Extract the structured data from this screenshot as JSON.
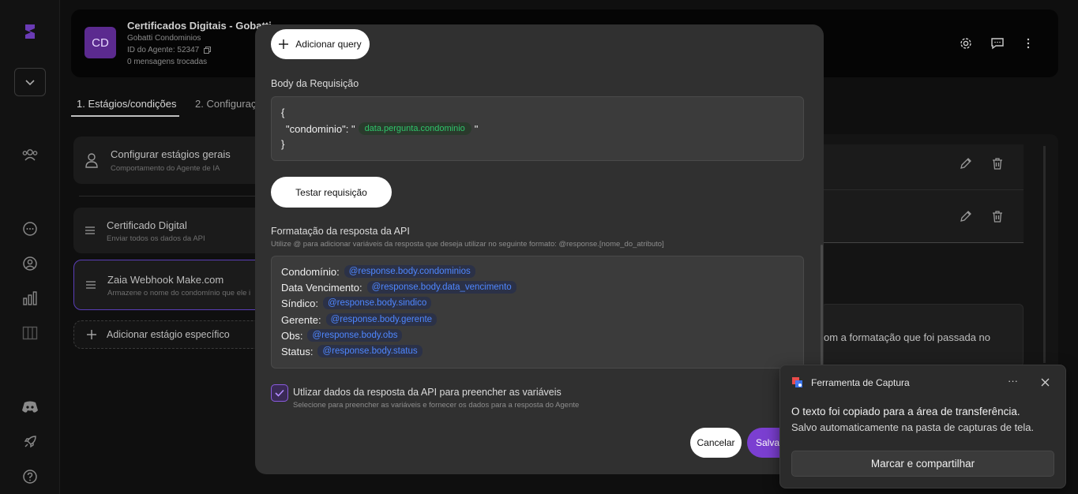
{
  "sidebar": {
    "icons": [
      "brand-logo-icon",
      "chevron-down-icon",
      "users-icon",
      "chat-icon",
      "user-circle-icon",
      "bar-chart-icon",
      "columns-icon",
      "discord-icon",
      "rocket-icon",
      "help-icon"
    ]
  },
  "agent": {
    "avatar": "CD",
    "title": "Certificados Digitais - Gobatti",
    "company": "Gobatti Condominios",
    "agent_id": "ID do Agente: 52347",
    "messages": "0 mensagens trocadas"
  },
  "tabs": [
    {
      "label": "1. Estágios/condições"
    },
    {
      "label": "2. Configuraç"
    }
  ],
  "stages": [
    {
      "title": "Configurar estágios gerais",
      "subtitle": "Comportamento do Agente de IA"
    },
    {
      "title": "Certificado Digital",
      "subtitle": "Enviar todos os dados da API"
    },
    {
      "title": "Zaia Webhook Make.com",
      "subtitle": "Armazene o nome do condomínio que ele i"
    },
    {
      "title": "Adicionar estágio específico"
    }
  ],
  "right_panel": {
    "text": "om a formatação que foi passada no"
  },
  "modal": {
    "add_query": "Adicionar query",
    "body_label": "Body da Requisição",
    "body_open": "{",
    "body_key": "\"condominio\": \"",
    "body_var": "data.pergunta.condominio",
    "body_quote": "\"",
    "body_close": "}",
    "test_button": "Testar requisição",
    "format_label": "Formatação da resposta da API",
    "format_hint": "Utilize @ para adicionar variáveis da resposta que deseja utilizar no seguinte formato: @response.[nome_do_atributo]",
    "format_lines": [
      {
        "label": "Condomínio:",
        "var": "@response.body.condominios"
      },
      {
        "label": "Data Vencimento:",
        "var": "@response.body.data_vencimento"
      },
      {
        "label": "Síndico:",
        "var": "@response.body.sindico"
      },
      {
        "label": "Gerente:",
        "var": "@response.body.gerente"
      },
      {
        "label": "Obs:",
        "var": "@response.body.obs"
      },
      {
        "label": "Status:",
        "var": "@response.body.status"
      }
    ],
    "checkbox_label": "Utlizar dados da resposta da API para preencher as variáveis",
    "checkbox_hint": "Selecione para preencher as variáveis e fornecer os dados para a resposta do Agente",
    "checkbox_checked": true,
    "cancel": "Cancelar",
    "save": "Salvar"
  },
  "toast": {
    "app_name": "Ferramenta de Captura",
    "line1": "O texto foi copiado para a área de transferência.",
    "line2": "Salvo automaticamente na pasta de capturas de tela.",
    "button": "Marcar e compartilhar",
    "more": "···"
  },
  "colors": {
    "accent": "#7b3fd1",
    "modal_bg": "#303030",
    "chip_green": "#2fc56b",
    "chip_blue": "#4f87ff"
  }
}
